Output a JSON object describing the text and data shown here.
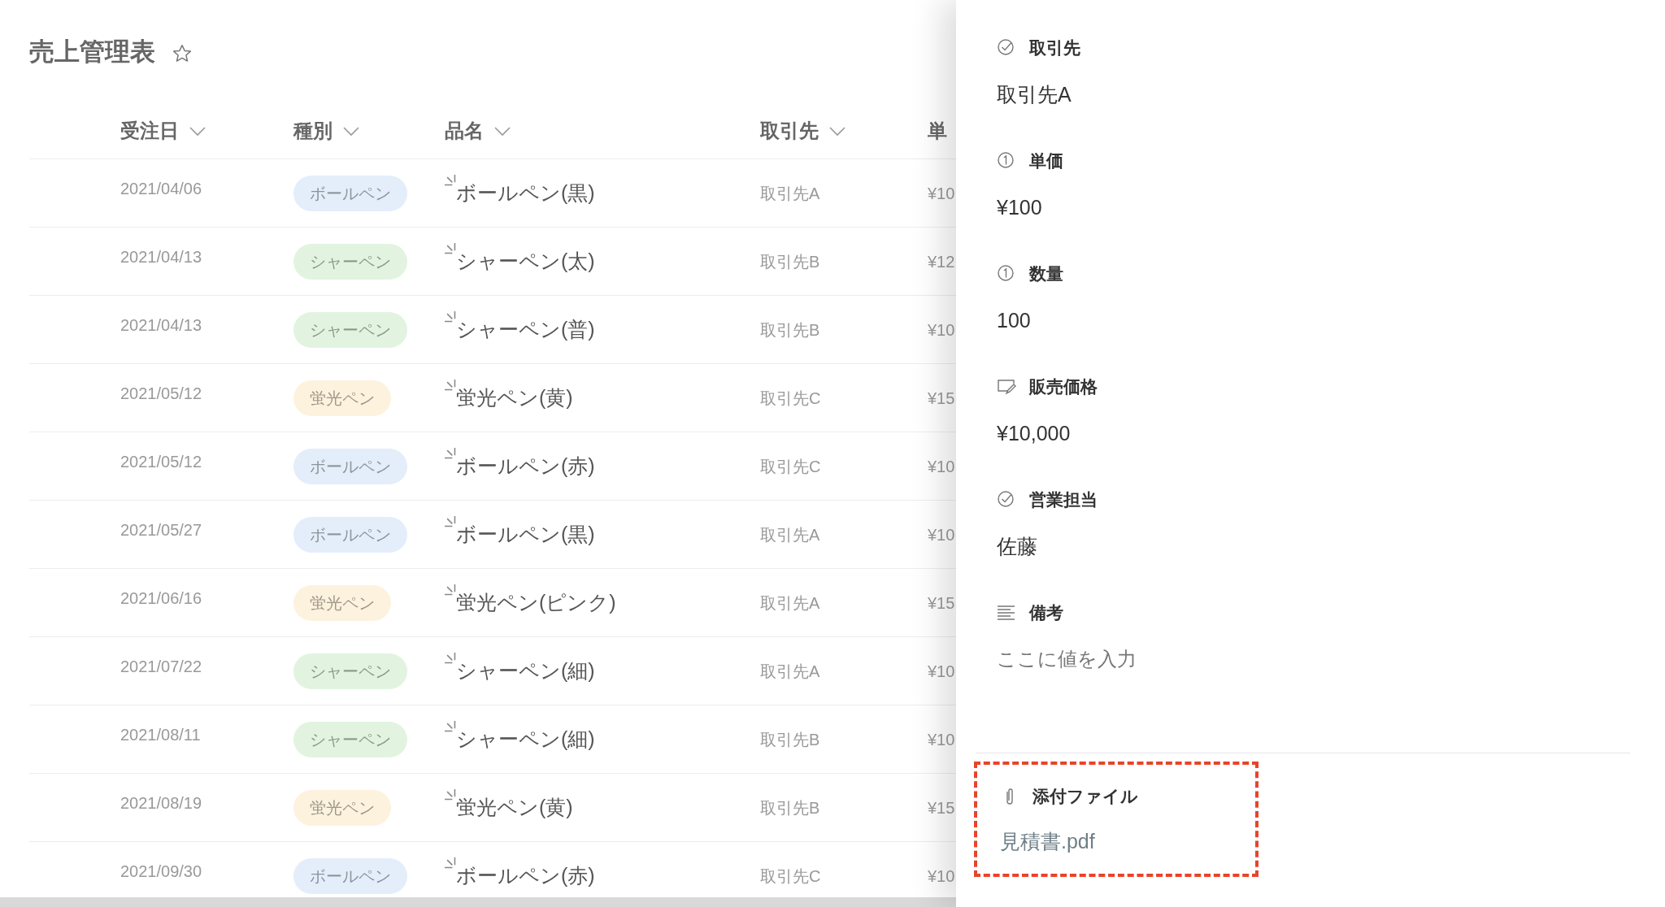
{
  "title": "売上管理表",
  "table": {
    "columns": [
      {
        "label": "受注日"
      },
      {
        "label": "種別"
      },
      {
        "label": "品名"
      },
      {
        "label": "取引先"
      },
      {
        "label": "単"
      }
    ],
    "rows": [
      {
        "date": "2021/04/06",
        "type": {
          "label": "ボールペン",
          "color": "#e4eefa"
        },
        "item": "ボールペン(黒)",
        "client": "取引先A",
        "price": "¥10"
      },
      {
        "date": "2021/04/13",
        "type": {
          "label": "シャーペン",
          "color": "#e2f4e0"
        },
        "item": "シャーペン(太)",
        "client": "取引先B",
        "price": "¥12"
      },
      {
        "date": "2021/04/13",
        "type": {
          "label": "シャーペン",
          "color": "#e2f4e0"
        },
        "item": "シャーペン(普)",
        "client": "取引先B",
        "price": "¥10"
      },
      {
        "date": "2021/05/12",
        "type": {
          "label": "蛍光ペン",
          "color": "#fdf2de"
        },
        "item": "蛍光ペン(黄)",
        "client": "取引先C",
        "price": "¥15"
      },
      {
        "date": "2021/05/12",
        "type": {
          "label": "ボールペン",
          "color": "#e4eefa"
        },
        "item": "ボールペン(赤)",
        "client": "取引先C",
        "price": "¥10"
      },
      {
        "date": "2021/05/27",
        "type": {
          "label": "ボールペン",
          "color": "#e4eefa"
        },
        "item": "ボールペン(黒)",
        "client": "取引先A",
        "price": "¥10"
      },
      {
        "date": "2021/06/16",
        "type": {
          "label": "蛍光ペン",
          "color": "#fdf2de"
        },
        "item": "蛍光ペン(ピンク)",
        "client": "取引先A",
        "price": "¥15"
      },
      {
        "date": "2021/07/22",
        "type": {
          "label": "シャーペン",
          "color": "#e2f4e0"
        },
        "item": "シャーペン(細)",
        "client": "取引先A",
        "price": "¥10"
      },
      {
        "date": "2021/08/11",
        "type": {
          "label": "シャーペン",
          "color": "#e2f4e0"
        },
        "item": "シャーペン(細)",
        "client": "取引先B",
        "price": "¥10"
      },
      {
        "date": "2021/08/19",
        "type": {
          "label": "蛍光ペン",
          "color": "#fdf2de"
        },
        "item": "蛍光ペン(黄)",
        "client": "取引先B",
        "price": "¥15"
      },
      {
        "date": "2021/09/30",
        "type": {
          "label": "ボールペン",
          "color": "#e4eefa"
        },
        "item": "ボールペン(赤)",
        "client": "取引先C",
        "price": "¥10"
      }
    ]
  },
  "detail_panel": {
    "fields": [
      {
        "kind": "choice",
        "label": "取引先",
        "value": "取引先A"
      },
      {
        "kind": "number",
        "label": "単価",
        "value": "¥100"
      },
      {
        "kind": "number",
        "label": "数量",
        "value": "100"
      },
      {
        "kind": "formula",
        "label": "販売価格",
        "value": "¥10,000"
      },
      {
        "kind": "choice",
        "label": "営業担当",
        "value": "佐藤"
      },
      {
        "kind": "text",
        "label": "備考",
        "placeholder": "ここに値を入力"
      }
    ],
    "attachment": {
      "label": "添付ファイル",
      "file": "見積書.pdf",
      "highlighted": true
    }
  }
}
